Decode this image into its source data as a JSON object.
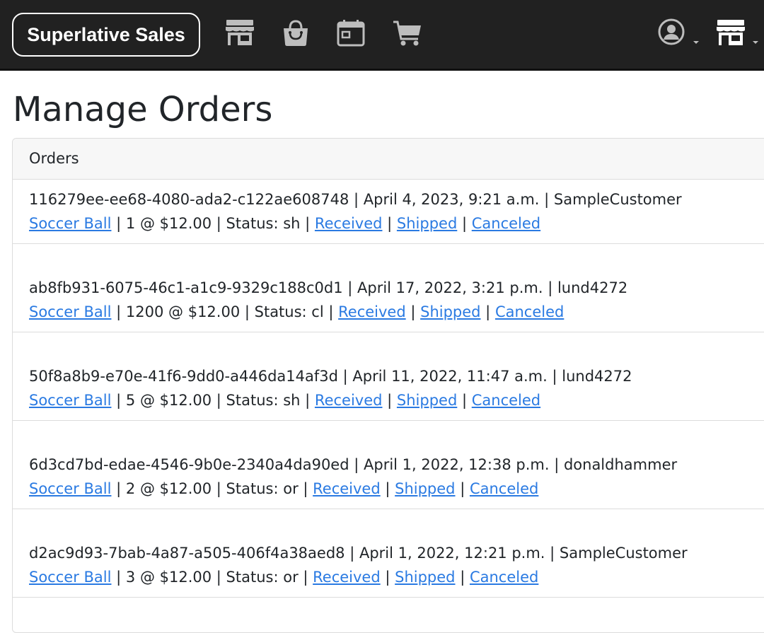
{
  "navbar": {
    "brand": "Superlative Sales",
    "icons": [
      "storefront-icon",
      "shopping-bag-icon",
      "calendar-icon",
      "cart-icon",
      "user-account-icon",
      "store-menu-icon"
    ],
    "bg_color": "#212121"
  },
  "page": {
    "title": "Manage Orders"
  },
  "orders_card": {
    "header": "Orders",
    "link_color": "#2a7ae2",
    "orders": [
      {
        "id": "116279ee-ee68-4080-ada2-c122ae608748",
        "date": "April 4, 2023, 9:21 a.m.",
        "customer": "SampleCustomer",
        "product": "Soccer Ball",
        "quantity": "1",
        "price": "$12.00",
        "status": "sh"
      },
      {
        "id": "ab8fb931-6075-46c1-a1c9-9329c188c0d1",
        "date": "April 17, 2022, 3:21 p.m.",
        "customer": "lund4272",
        "product": "Soccer Ball",
        "quantity": "1200",
        "price": "$12.00",
        "status": "cl"
      },
      {
        "id": "50f8a8b9-e70e-41f6-9dd0-a446da14af3d",
        "date": "April 11, 2022, 11:47 a.m.",
        "customer": "lund4272",
        "product": "Soccer Ball",
        "quantity": "5",
        "price": "$12.00",
        "status": "sh"
      },
      {
        "id": "6d3cd7bd-edae-4546-9b0e-2340a4da90ed",
        "date": "April 1, 2022, 12:38 p.m.",
        "customer": "donaldhammer",
        "product": "Soccer Ball",
        "quantity": "2",
        "price": "$12.00",
        "status": "or"
      },
      {
        "id": "d2ac9d93-7bab-4a87-a505-406f4a38aed8",
        "date": "April 1, 2022, 12:21 p.m.",
        "customer": "SampleCustomer",
        "product": "Soccer Ball",
        "quantity": "3",
        "price": "$12.00",
        "status": "or"
      }
    ],
    "actions": {
      "received": "Received",
      "shipped": "Shipped",
      "canceled": "Canceled"
    },
    "labels": {
      "separator": " | ",
      "at": " @ ",
      "status_prefix": "Status: "
    }
  }
}
